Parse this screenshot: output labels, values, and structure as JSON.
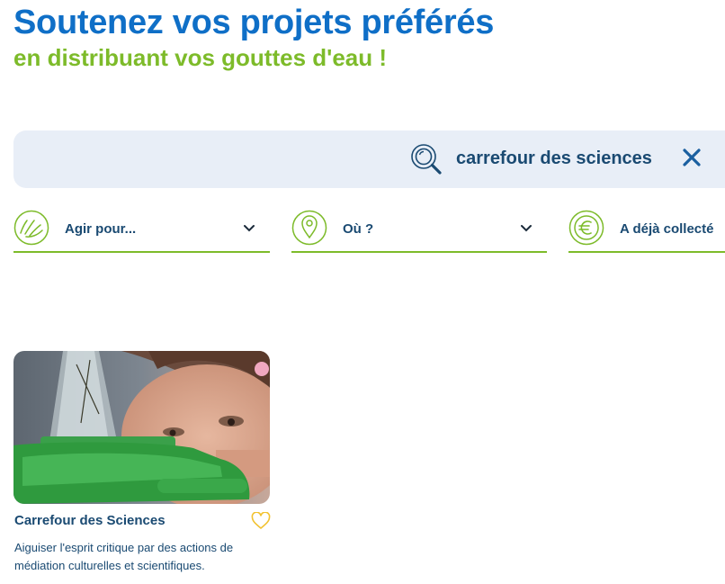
{
  "header": {
    "title": "Soutenez vos projets préférés",
    "subtitle": "en distribuant vos gouttes d'eau !"
  },
  "search": {
    "query": "carrefour des sciences",
    "icon": "search-icon",
    "clear_icon": "close-icon"
  },
  "filters": [
    {
      "label": "Agir pour...",
      "icon": "hands-icon"
    },
    {
      "label": "Où ?",
      "icon": "location-pin-icon"
    },
    {
      "label": "A déjà collecté",
      "icon": "euro-icon"
    }
  ],
  "results": [
    {
      "title": "Carrefour des Sciences",
      "description": "Aiguiser l'esprit critique par des actions de médiation culturelles et scientifiques.",
      "favorite_icon": "heart-icon"
    }
  ],
  "colors": {
    "primary_blue": "#0f6fc7",
    "accent_green": "#7dbb2a",
    "text_navy": "#1a4a72",
    "search_bg": "#e8eef7",
    "heart_yellow": "#f2c230"
  }
}
